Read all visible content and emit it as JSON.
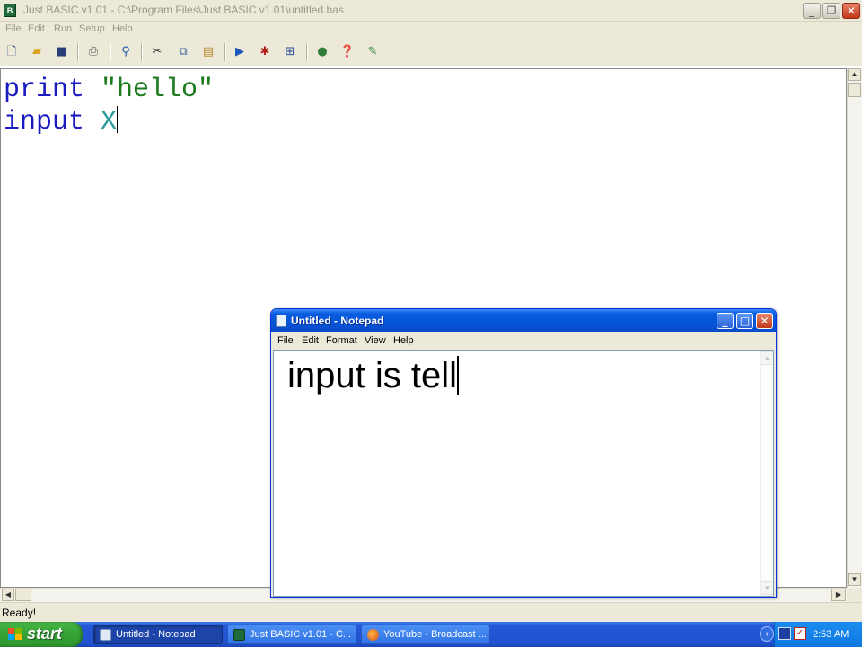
{
  "main_window": {
    "title": "Just BASIC v1.01 - C:\\Program Files\\Just BASIC v1.01\\untitled.bas",
    "app_icon_glyph": "B",
    "controls": {
      "minimize": "_",
      "maximize": "❐",
      "close": "✕"
    },
    "menu": [
      "File",
      "Edit",
      "Run",
      "Setup",
      "Help"
    ],
    "toolbar_icons": [
      "new-file-icon",
      "open-folder-icon",
      "save-disk-icon",
      "print-icon",
      "find-icon",
      "cut-icon",
      "copy-icon",
      "paste-icon",
      "run-icon",
      "debug-bug-icon",
      "kill-window-icon",
      "internet-globe-icon",
      "help-icon",
      "edit-notes-icon"
    ],
    "code": {
      "line1": {
        "keyword": "print",
        "string": "\"hello\""
      },
      "line2": {
        "keyword": "input",
        "variable": "X"
      }
    },
    "status_text": "Ready!"
  },
  "notepad": {
    "title": "Untitled - Notepad",
    "controls": {
      "minimize": "_",
      "maximize": "□",
      "close": "✕"
    },
    "menu": [
      "File",
      "Edit",
      "Format",
      "View",
      "Help"
    ],
    "text": "input is tell"
  },
  "taskbar": {
    "start_label": "start",
    "tasks": [
      {
        "label": "Untitled - Notepad",
        "active": true
      },
      {
        "label": "Just BASIC v1.01 - C...",
        "active": false
      },
      {
        "label": "YouTube - Broadcast ...",
        "active": false
      }
    ],
    "tray_arrow": "‹",
    "clock": "2:53 AM"
  },
  "colors": {
    "keyword": "#1a1ac0",
    "string": "#1d7a1d",
    "variable": "#2a9a9a",
    "xp_blue": "#2458d6",
    "start_green": "#37a537"
  }
}
